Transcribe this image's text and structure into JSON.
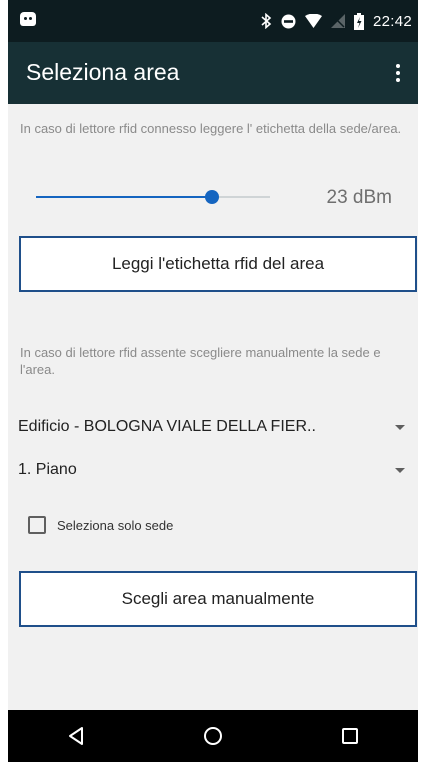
{
  "status_bar": {
    "time": "22:42",
    "icons": [
      "android-notification-icon",
      "bluetooth-icon",
      "do-not-disturb-icon",
      "wifi-icon",
      "no-signal-icon",
      "battery-icon"
    ]
  },
  "toolbar": {
    "title": "Seleziona area",
    "menu_icon": "more-vert-icon"
  },
  "rfid_section": {
    "hint": "In caso di lettore rfid connesso leggere l' etichetta della sede/area.",
    "power_slider_level": 0.75,
    "power_value": "23 dBm",
    "read_button_label": "Leggi l'etichetta rfid del area"
  },
  "manual_section": {
    "hint": "In caso di lettore rfid assente scegliere manualmente la sede e l'area.",
    "building_dropdown_value": "Edificio - BOLOGNA VIALE DELLA FIER..",
    "floor_dropdown_value": "1. Piano",
    "site_only_label": "Seleziona solo sede",
    "site_only_checked": false,
    "manual_button_label": "Scegli area manualmente"
  },
  "nav_bar": {
    "buttons": [
      "back-icon",
      "home-icon",
      "recents-icon"
    ]
  },
  "colors": {
    "status_bar": "#0d1c20",
    "toolbar": "#173035",
    "accent": "#1565c0",
    "button_border": "#1f4f8a",
    "background": "#f1f1f1"
  }
}
